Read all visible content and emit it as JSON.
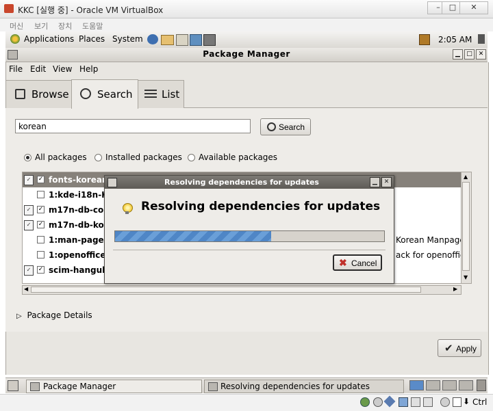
{
  "host": {
    "title": "KKC [실행 중] - Oracle VM VirtualBox",
    "controls": [
      "–",
      "□",
      "✕"
    ],
    "menu": [
      "머신",
      "보기",
      "장치",
      "도움말"
    ],
    "host_key": "Ctrl"
  },
  "panel": {
    "menus": [
      "Applications",
      "Places",
      "System"
    ],
    "clock": "2:05 AM"
  },
  "window": {
    "title": "Package Manager",
    "menu": [
      "File",
      "Edit",
      "View",
      "Help"
    ],
    "tabs": [
      "Browse",
      "Search",
      "List"
    ],
    "active_tab": "Search"
  },
  "search": {
    "value": "korean",
    "button_label": "Search"
  },
  "filters": {
    "options": [
      "All packages",
      "Installed packages",
      "Available packages"
    ],
    "selected": "All packages"
  },
  "packages": [
    {
      "name": "fonts-korean",
      "checked": true,
      "installed": true,
      "summary": ""
    },
    {
      "name": "1:kde-i18n-K",
      "checked": false,
      "installed": false,
      "summary": ""
    },
    {
      "name": "m17n-db-co",
      "checked": true,
      "installed": true,
      "summary": ""
    },
    {
      "name": "m17n-db-ko",
      "checked": true,
      "installed": true,
      "summary": ""
    },
    {
      "name": "1:man-pages",
      "checked": false,
      "installed": false,
      "summary": "Korean Manpage"
    },
    {
      "name": "1:openoffice",
      "checked": false,
      "installed": false,
      "summary": "ack for openoffice"
    },
    {
      "name": "scim-hangul",
      "checked": true,
      "installed": true,
      "summary": ""
    }
  ],
  "details_label": "Package Details",
  "apply_label": "Apply",
  "dialog": {
    "title": "Resolving dependencies for updates",
    "heading": "Resolving dependencies for updates",
    "progress": 0.58,
    "cancel_label": "Cancel"
  },
  "taskbar": {
    "items": [
      "Package Manager",
      "Resolving dependencies for updates"
    ]
  },
  "colors": {
    "selection": "#86817a",
    "progress": "#4f86c6",
    "window_bg": "#eeece8"
  }
}
